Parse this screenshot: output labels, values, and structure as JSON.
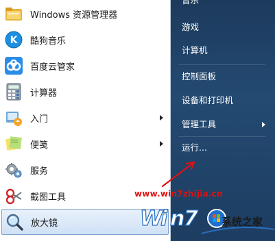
{
  "programs": [
    {
      "label": "Windows 资源管理器",
      "icon": "folder-icon",
      "has_submenu": false
    },
    {
      "label": "酷狗音乐",
      "icon": "kugou-icon",
      "has_submenu": false
    },
    {
      "label": "百度云管家",
      "icon": "baidu-cloud-icon",
      "has_submenu": false
    },
    {
      "label": "计算器",
      "icon": "calculator-icon",
      "has_submenu": false
    },
    {
      "label": "入门",
      "icon": "getting-started-icon",
      "has_submenu": true
    },
    {
      "label": "便笺",
      "icon": "sticky-notes-icon",
      "has_submenu": true
    },
    {
      "label": "服务",
      "icon": "services-icon",
      "has_submenu": false
    },
    {
      "label": "截图工具",
      "icon": "snipping-tool-icon",
      "has_submenu": false
    },
    {
      "label": "放大镜",
      "icon": "magnifier-icon",
      "has_submenu": false,
      "selected": true
    }
  ],
  "places": [
    {
      "label": "音乐",
      "has_submenu": false
    },
    {
      "label": "游戏",
      "has_submenu": false
    },
    {
      "label": "计算机",
      "has_submenu": false
    },
    {
      "label": "控制面板",
      "has_submenu": false
    },
    {
      "label": "设备和打印机",
      "has_submenu": false
    },
    {
      "label": "管理工具",
      "has_submenu": true
    },
    {
      "label": "运行...",
      "has_submenu": false
    }
  ],
  "watermark": {
    "url": "www.win7zhijia.cn",
    "brand": "系统之家",
    "logo_text": "Win7"
  },
  "colors": {
    "right_pane": "#244a72",
    "selection": "#cfe1f6",
    "annotation_arrow": "#e01010"
  }
}
